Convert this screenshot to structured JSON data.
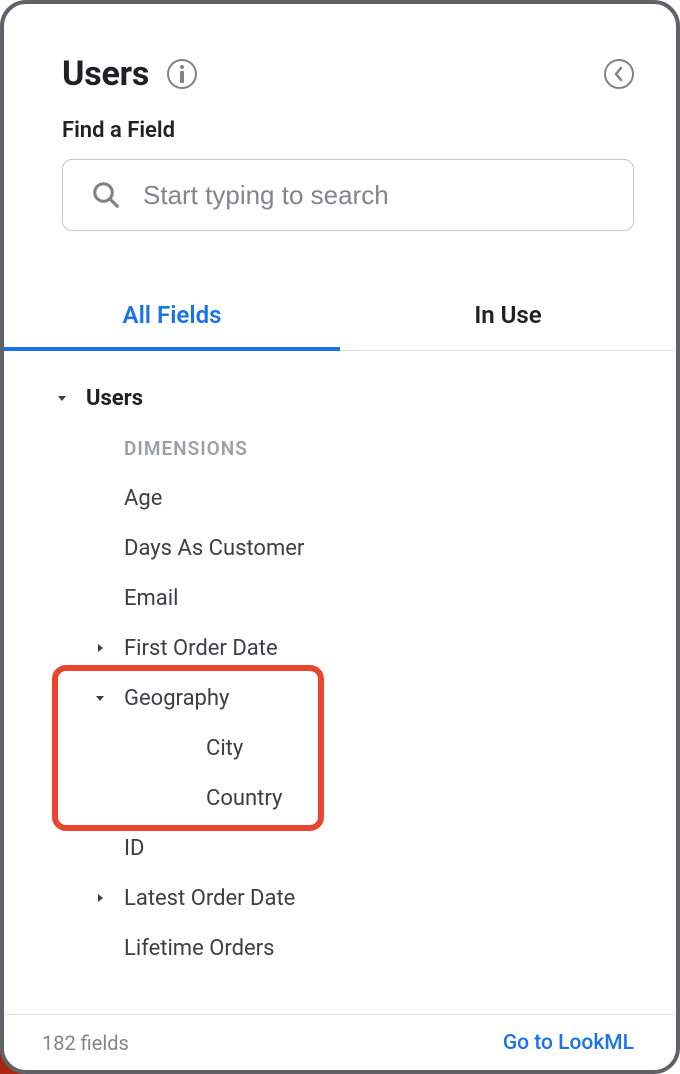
{
  "header": {
    "title": "Users"
  },
  "search": {
    "label": "Find a Field",
    "placeholder": "Start typing to search"
  },
  "tabs": {
    "all_fields": "All Fields",
    "in_use": "In Use"
  },
  "tree": {
    "view_name": "Users",
    "section_label": "DIMENSIONS",
    "fields": [
      {
        "label": "Age",
        "expandable": false
      },
      {
        "label": "Days As Customer",
        "expandable": false
      },
      {
        "label": "Email",
        "expandable": false
      },
      {
        "label": "First Order Date",
        "expandable": true,
        "expanded": false
      },
      {
        "label": "Geography",
        "expandable": true,
        "expanded": true,
        "children": [
          "City",
          "Country"
        ]
      },
      {
        "label": "ID",
        "expandable": false
      },
      {
        "label": "Latest Order Date",
        "expandable": true,
        "expanded": false
      },
      {
        "label": "Lifetime Orders",
        "expandable": false
      }
    ]
  },
  "footer": {
    "count_text": "182 fields",
    "link_text": "Go to LookML"
  },
  "highlight": {
    "field_index": 4
  }
}
